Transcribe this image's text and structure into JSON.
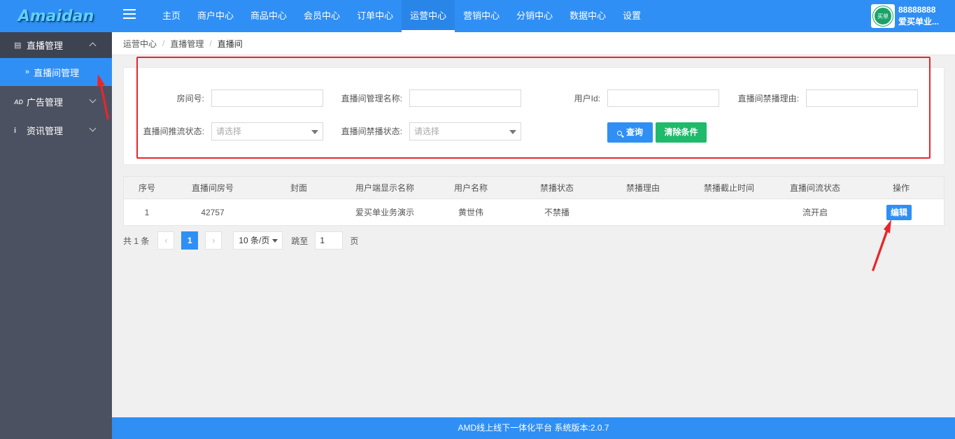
{
  "header": {
    "logo": "Amaidan",
    "nav": [
      {
        "label": "主页",
        "active": false
      },
      {
        "label": "商户中心",
        "active": false
      },
      {
        "label": "商品中心",
        "active": false
      },
      {
        "label": "会员中心",
        "active": false
      },
      {
        "label": "订单中心",
        "active": false
      },
      {
        "label": "运营中心",
        "active": true
      },
      {
        "label": "营销中心",
        "active": false
      },
      {
        "label": "分销中心",
        "active": false
      },
      {
        "label": "数据中心",
        "active": false
      },
      {
        "label": "设置",
        "active": false
      }
    ],
    "user": {
      "avatar_text": "买单",
      "id": "88888888",
      "name": "爱买单业..."
    }
  },
  "sidebar": {
    "groups": [
      {
        "label": "直播管理",
        "icon": "list-icon",
        "open": true,
        "children": [
          {
            "label": "直播间管理",
            "active": true
          }
        ]
      },
      {
        "label": "广告管理",
        "icon": "ad-icon",
        "open": false
      },
      {
        "label": "资讯管理",
        "icon": "info-icon",
        "open": false
      }
    ]
  },
  "breadcrumb": [
    "运营中心",
    "直播管理",
    "直播间"
  ],
  "search": {
    "room_no_label": "房间号:",
    "room_no_value": "",
    "room_name_label": "直播间管理名称:",
    "room_name_value": "",
    "user_id_label": "用户Id:",
    "user_id_value": "",
    "ban_reason_label": "直播间禁播理由:",
    "ban_reason_value": "",
    "push_status_label": "直播间推流状态:",
    "push_status_placeholder": "请选择",
    "ban_status_label": "直播间禁播状态:",
    "ban_status_placeholder": "请选择",
    "query_label": "查询",
    "clear_label": "清除条件"
  },
  "table": {
    "columns": [
      "序号",
      "直播间房号",
      "封面",
      "用户端显示名称",
      "用户名称",
      "禁播状态",
      "禁播理由",
      "禁播截止时间",
      "直播间流状态",
      "操作"
    ],
    "rows": [
      {
        "index": "1",
        "room_no": "42757",
        "cover": "",
        "display_name": "爱买单业务演示",
        "user_name": "黄世伟",
        "ban_status": "不禁播",
        "ban_reason": "",
        "ban_until": "",
        "stream_status": "流开启",
        "action": "编辑"
      }
    ]
  },
  "pagination": {
    "total_text": "共 1 条",
    "current_page": "1",
    "page_size": "10 条/页",
    "jump_label": "跳至",
    "jump_value": "1",
    "page_suffix": "页"
  },
  "footer": {
    "text": "AMD线上线下一体化平台 系统版本:2.0.7"
  },
  "colors": {
    "primary": "#2f8ff5",
    "success": "#1dbb6b",
    "sidebar": "#4c5161",
    "highlight": "#e8262a"
  }
}
